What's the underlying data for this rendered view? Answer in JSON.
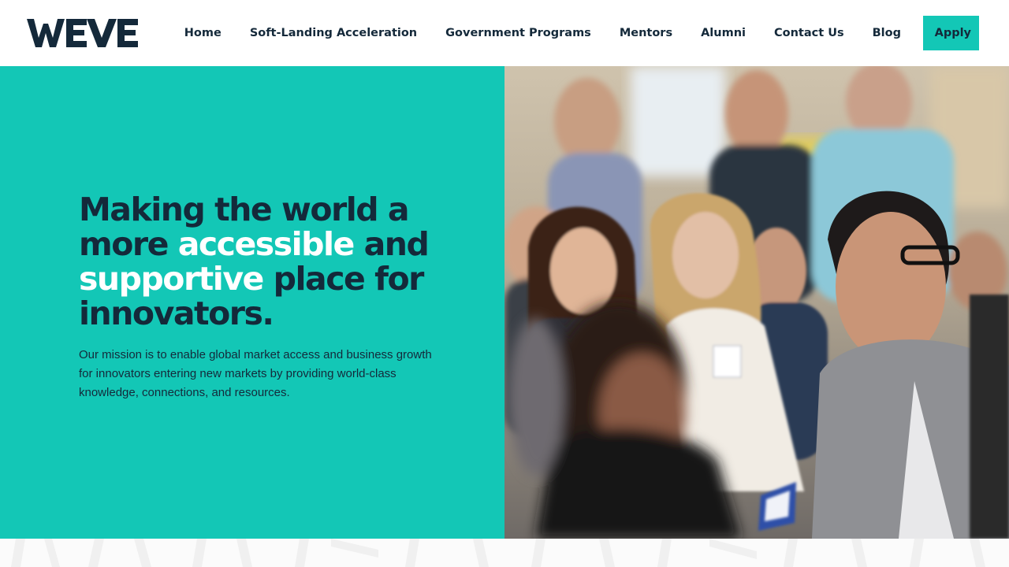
{
  "brand": {
    "logo_text": "WEVE",
    "accent_color": "#13c7b6",
    "text_color": "#14293a"
  },
  "nav": {
    "items": [
      {
        "label": "Home"
      },
      {
        "label": "Soft-Landing Acceleration"
      },
      {
        "label": "Government Programs"
      },
      {
        "label": "Mentors"
      },
      {
        "label": "Alumni"
      },
      {
        "label": "Contact Us"
      },
      {
        "label": "Blog"
      }
    ],
    "apply_label": "Apply"
  },
  "hero": {
    "headline_part1": "Making the world a more ",
    "headline_highlight1": "accessible",
    "headline_part2": " and ",
    "headline_highlight2": "supportive",
    "headline_part3": " place for innovators.",
    "mission": "Our mission is to enable global market access and business growth for innovators entering new markets by providing world-class knowledge, connections, and resources.",
    "image_subject": "audience seated at an event"
  }
}
